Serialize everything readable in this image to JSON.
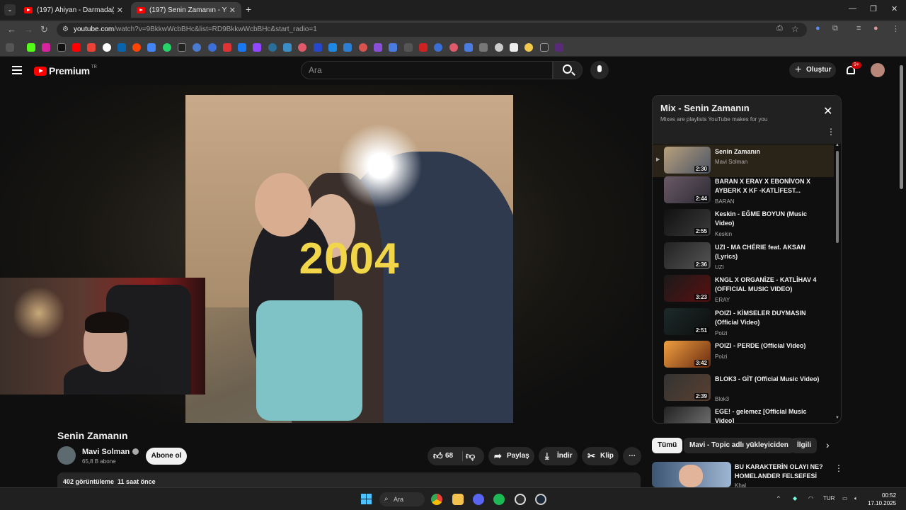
{
  "browser": {
    "tabs": [
      {
        "label": "(197) Ahiyan - Darmadağın (Offi"
      },
      {
        "label": "(197) Senin Zamanın - YouTube"
      }
    ],
    "url_host": "youtube.com",
    "url_path": "/watch?v=9BkkwWcbBHc&list=RD9BkkwWcbBHc&start_radio=1"
  },
  "youtube": {
    "logo_text": "Premium",
    "region": "TR",
    "search_placeholder": "Ara",
    "create_label": "Oluştur",
    "notif_badge": "9+"
  },
  "video": {
    "overlay_text": "2004",
    "title": "Senin Zamanın",
    "channel": "Mavi Solman",
    "subscribers": "65,8 B abone",
    "subscribe_label": "Abone ol",
    "likes": "68",
    "share_label": "Paylaş",
    "download_label": "İndir",
    "clip_label": "Klip",
    "views": "402 görüntüleme",
    "age": "11 saat önce"
  },
  "playlist": {
    "title": "Mix - Senin Zamanın",
    "subtitle": "Mixes are playlists YouTube makes for you",
    "items": [
      {
        "title": "Senin Zamanın",
        "artist": "Mavi Solman",
        "duration": "2:30"
      },
      {
        "title": "BARAN X ERAY X EBONİVON X AYBERK X KF -KATLİFEST...",
        "artist": "BARAN",
        "duration": "2:44"
      },
      {
        "title": "Keskin - EĞME BOYUN (Music Video)",
        "artist": "Keskin",
        "duration": "2:55"
      },
      {
        "title": "UZI - MA CHÉRIE feat. AKSAN (Lyrics)",
        "artist": "UZI",
        "duration": "2:36"
      },
      {
        "title": "KNGL X ORGANİZE - KATLİHAV 4 (OFFICIAL MUSIC VIDEO)",
        "artist": "ERAY",
        "duration": "3:23"
      },
      {
        "title": "POIZI - KİMSELER DUYMASIN (Official Video)",
        "artist": "Poizi",
        "duration": "2:51"
      },
      {
        "title": "POIZI - PERDE (Official Video)",
        "artist": "Poizi",
        "duration": "3:42"
      },
      {
        "title": "BLOK3 - GİT (Official Music Video)",
        "artist": "Blok3",
        "duration": "2:39"
      },
      {
        "title": "EGE! - gelemez [Official Music Video]",
        "artist": "",
        "duration": ""
      }
    ]
  },
  "chips": [
    "Tümü",
    "Mavi - Topic adlı yükleyiciden",
    "İlgili"
  ],
  "recommended": {
    "title": "BU KARAKTERİN OLAYI NE? HOMELANDER FELSEFESİ",
    "channel": "Khal"
  },
  "taskbar": {
    "search_label": "Ara",
    "lang": "TUR",
    "time": "00:52",
    "date": "17.10.2025"
  }
}
